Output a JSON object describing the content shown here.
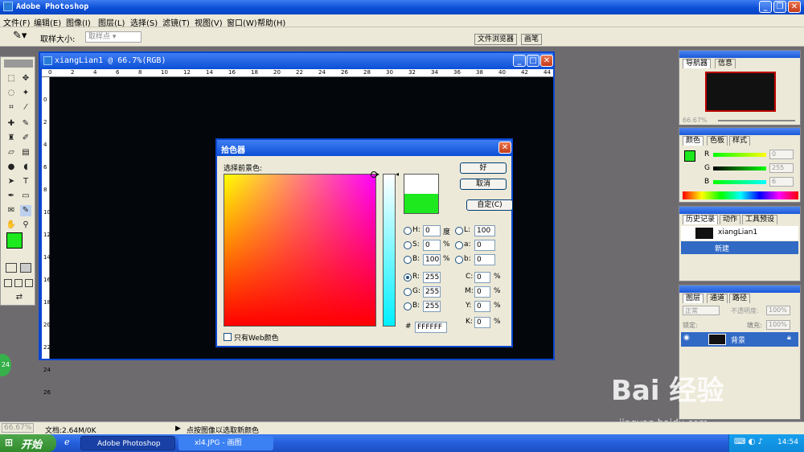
{
  "app": {
    "title": "Adobe Photoshop"
  },
  "menu": [
    "文件(F)",
    "编辑(E)",
    "图像(I)",
    "图层(L)",
    "选择(S)",
    "滤镜(T)",
    "视图(V)",
    "窗口(W)",
    "帮助(H)"
  ],
  "options_bar": {
    "sample_size_label": "取样大小:",
    "sample_size_value": "取样点"
  },
  "palette_well": {
    "tab1": "文件浏览器",
    "tab2": "画笔"
  },
  "document": {
    "title": "xiangLian1 @ 66.7%(RGB)",
    "ruler_h": [
      "0",
      "2",
      "4",
      "6",
      "8",
      "10",
      "12",
      "14",
      "16",
      "18",
      "20",
      "22",
      "24",
      "26",
      "28",
      "30",
      "32",
      "34",
      "36",
      "38",
      "40",
      "42",
      "44"
    ],
    "ruler_v": [
      "0",
      "2",
      "4",
      "6",
      "8",
      "10",
      "12",
      "14",
      "16",
      "18",
      "20",
      "22",
      "24",
      "26"
    ],
    "canvas_color": "#03060b"
  },
  "color_picker": {
    "title": "拾色器",
    "prompt": "选择前景色:",
    "buttons": {
      "ok": "好",
      "cancel": "取消",
      "custom": "自定(C)"
    },
    "hsb": {
      "h_label": "H:",
      "h": "0",
      "h_unit": "度",
      "s_label": "S:",
      "s": "0",
      "s_unit": "%",
      "b_label": "B:",
      "b": "100",
      "b_unit": "%"
    },
    "rgb": {
      "r_label": "R:",
      "r": "255",
      "g_label": "G:",
      "g": "255",
      "b_label": "B:",
      "b": "255"
    },
    "lab": {
      "l_label": "L:",
      "l": "100",
      "a_label": "a:",
      "a": "0",
      "b_label": "b:",
      "b": "0"
    },
    "cmyk": {
      "c_label": "C:",
      "c": "0",
      "m_label": "M:",
      "m": "0",
      "y_label": "Y:",
      "y": "0",
      "k_label": "K:",
      "k": "0",
      "unit": "%"
    },
    "hex_label": "#",
    "hex": "FFFFFF",
    "web_only": "只有Web颜色",
    "new_color": "#ffffff",
    "current_color": "#1ee81e"
  },
  "navigator": {
    "tabs": [
      "导航器",
      "信息"
    ],
    "zoom": "66.67%"
  },
  "color_panel": {
    "tabs": [
      "颜色",
      "色板",
      "样式"
    ],
    "r_label": "R",
    "r": "0",
    "g_label": "G",
    "g": "255",
    "b_label": "B",
    "b": "6",
    "foreground": "#1ee81e"
  },
  "history": {
    "tabs": [
      "历史记录",
      "动作",
      "工具预设"
    ],
    "snapshot": "xiangLian1",
    "items": [
      "新建"
    ]
  },
  "layers": {
    "tabs": [
      "图层",
      "通道",
      "路径"
    ],
    "blend_mode": "正常",
    "opacity_label": "不透明度:",
    "opacity": "100%",
    "lock_label": "锁定:",
    "fill_label": "填充:",
    "fill": "100%",
    "layer_name": "背景"
  },
  "statusbar": {
    "zoom": "66.67%",
    "doc_size": "文档:2.64M/0K",
    "hint": "点按图像以选取新颜色"
  },
  "taskbar": {
    "start": "开始",
    "tasks": [
      "Adobe Photoshop",
      "xl4.JPG - 画图"
    ],
    "clock": "14:54"
  },
  "badge": "24",
  "watermark": {
    "logo": "Bai 经验",
    "url": "jingyan.baidu.com"
  }
}
